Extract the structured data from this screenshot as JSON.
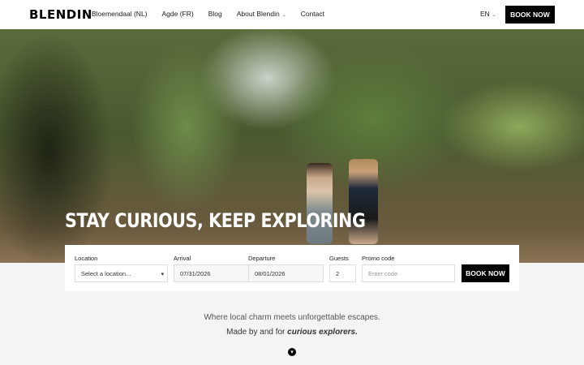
{
  "nav": {
    "logo": "BLENDIN",
    "items": [
      {
        "label": "Bloemendaal (NL)"
      },
      {
        "label": "Agde (FR)"
      },
      {
        "label": "Blog"
      },
      {
        "label": "About Blendin"
      },
      {
        "label": "Contact"
      }
    ],
    "language": "EN",
    "book_label": "BOOK NOW"
  },
  "hero": {
    "title": "STAY CURIOUS, KEEP EXPLORING"
  },
  "booking": {
    "location_label": "Location",
    "location_value": "Select a location...",
    "arrival_label": "Arrival",
    "arrival_value": "07/31/2026",
    "departure_label": "Departure",
    "departure_value": "08/01/2026",
    "guests_label": "Guests",
    "guests_value": "2",
    "promo_label": "Promo code",
    "promo_placeholder": "Enter code",
    "book_label": "BOOK NOW"
  },
  "tagline": {
    "line1": "Where local charm meets unforgettable escapes.",
    "line2_prefix": "Made by and for",
    "line2_emphasis": "curious explorers."
  }
}
